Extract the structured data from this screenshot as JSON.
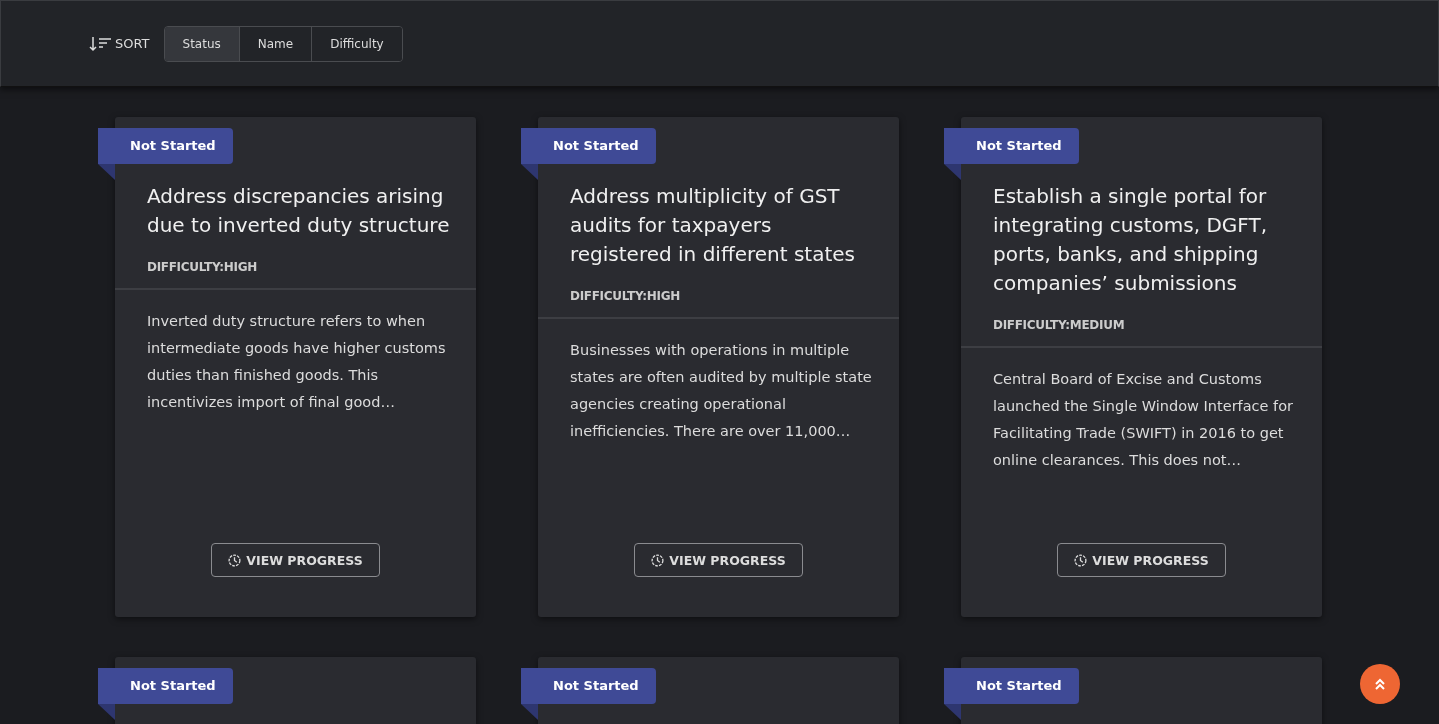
{
  "sort": {
    "label": "SORT",
    "options": [
      {
        "label": "Status",
        "selected": true
      },
      {
        "label": "Name",
        "selected": false
      },
      {
        "label": "Difficulty",
        "selected": false
      }
    ]
  },
  "cards": [
    {
      "status": "Not Started",
      "title": "Address discrepancies arising due to inverted duty structure",
      "difficulty": "DIFFICULTY:HIGH",
      "description": "Inverted duty structure refers to when intermediate goods have higher customs duties than finished goods. This incentivizes import of final good…",
      "action": "VIEW PROGRESS"
    },
    {
      "status": "Not Started",
      "title": "Address multiplicity of GST audits for taxpayers registered in different states",
      "difficulty": "DIFFICULTY:HIGH",
      "description": "Businesses with operations in multiple states are often audited by multiple state agencies creating operational inefficiencies. There are over 11,000…",
      "action": "VIEW PROGRESS"
    },
    {
      "status": "Not Started",
      "title": "Establish a single portal for integrating customs, DGFT, ports, banks, and shipping companies’ submissions",
      "difficulty": "DIFFICULTY:MEDIUM",
      "description": "Central Board of Excise and Customs launched the Single Window Interface for Facilitating Trade (SWIFT) in 2016 to get online clearances. This does not…",
      "action": "VIEW PROGRESS"
    },
    {
      "status": "Not Started"
    },
    {
      "status": "Not Started"
    },
    {
      "status": "Not Started"
    }
  ]
}
